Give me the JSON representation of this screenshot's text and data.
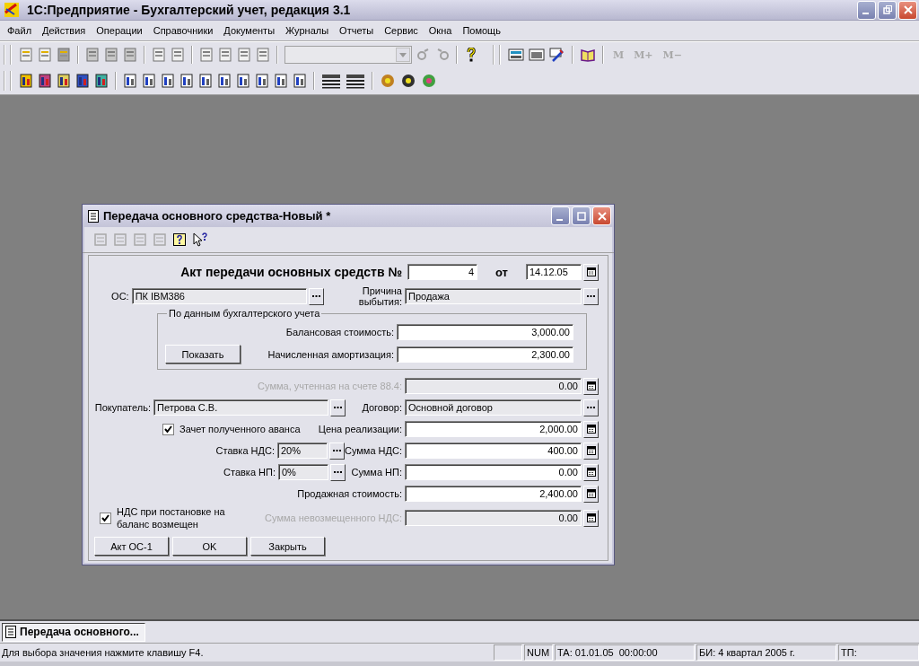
{
  "app_window": {
    "title": "1С:Предприятие - Бухгалтерский учет, редакция 3.1"
  },
  "menu": [
    "Файл",
    "Действия",
    "Операции",
    "Справочники",
    "Документы",
    "Журналы",
    "Отчеты",
    "Сервис",
    "Окна",
    "Помощь"
  ],
  "memory_buttons": [
    {
      "label": "M",
      "disabled": true
    },
    {
      "label": "M+",
      "disabled": true
    },
    {
      "label": "M−",
      "disabled": true
    }
  ],
  "document_window": {
    "title": "Передача основного средства-Новый *",
    "heading": "Акт передачи основных средств №",
    "number": "4",
    "date_label": "от",
    "date": "14.12.05",
    "os": {
      "label": "ОС:",
      "value": "ПК IBM386"
    },
    "reason": {
      "label": "Причина выбытия:",
      "value": "Продажа"
    },
    "group": {
      "title": "По данным бухгалтерского учета",
      "button": "Показать",
      "balance": {
        "label": "Балансовая стоимость:",
        "value": "3,000.00"
      },
      "depreciation": {
        "label": "Начисленная амортизация:",
        "value": "2,300.00"
      }
    },
    "account_884": {
      "label": "Сумма, учтенная на счете 88.4:",
      "value": "0.00",
      "disabled": true
    },
    "buyer": {
      "label": "Покупатель:",
      "value": "Петрова С.В."
    },
    "contract": {
      "label": "Договор:",
      "value": "Основной договор"
    },
    "advance": {
      "label": "Зачет полученного аванса",
      "checked": true
    },
    "price": {
      "label": "Цена реализации:",
      "value": "2,000.00",
      "disabled": false
    },
    "vat_rate": {
      "label": "Ставка НДС:",
      "value": "20%"
    },
    "vat_sum": {
      "label": "Сумма НДС:",
      "value": "400.00",
      "disabled": false
    },
    "np_rate": {
      "label": "Ставка НП:",
      "value": "0%"
    },
    "np_sum": {
      "label": "Сумма НП:",
      "value": "0.00",
      "disabled": false
    },
    "sale_cost": {
      "label": "Продажная стоимость:",
      "value": "2,400.00",
      "disabled": false
    },
    "vat_refunded": {
      "label": "НДС при постановке на баланс возмещен",
      "checked": true
    },
    "unrefunded_vat": {
      "label": "Сумма невозмещенного НДС:",
      "value": "0.00",
      "disabled": true
    },
    "buttons": [
      "Акт ОС-1",
      "OK",
      "Закрыть"
    ]
  },
  "taskbar": [
    {
      "label": "Передача основного...",
      "selected": true
    }
  ],
  "status_bar": {
    "message": "Для выбора значения нажмите клавишу F4.",
    "cells": [
      "NUM",
      "ТА: 01.01.05  00:00:00",
      "БИ: 4 квартал 2005 г.",
      "ТП:"
    ]
  }
}
